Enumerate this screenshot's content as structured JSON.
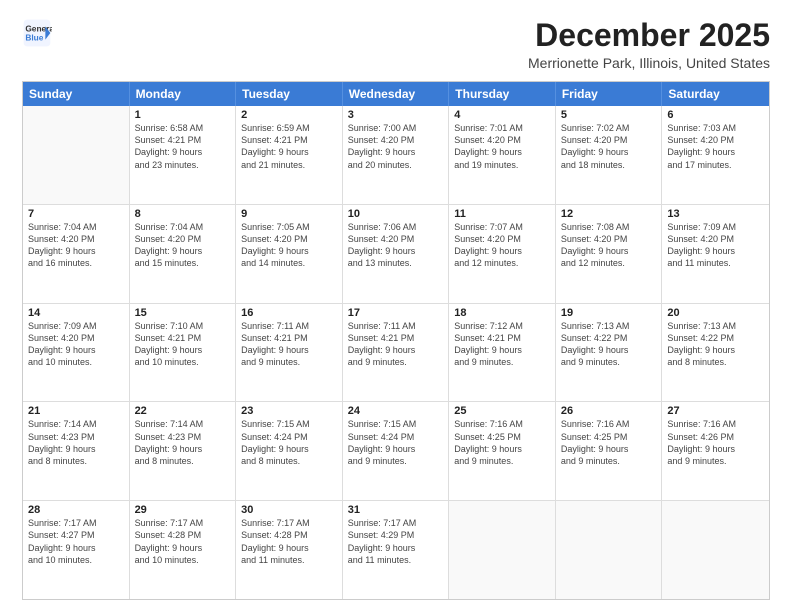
{
  "logo": {
    "line1": "General",
    "line2": "Blue"
  },
  "title": "December 2025",
  "subtitle": "Merrionette Park, Illinois, United States",
  "days_of_week": [
    "Sunday",
    "Monday",
    "Tuesday",
    "Wednesday",
    "Thursday",
    "Friday",
    "Saturday"
  ],
  "weeks": [
    [
      {
        "day": "",
        "lines": []
      },
      {
        "day": "1",
        "lines": [
          "Sunrise: 6:58 AM",
          "Sunset: 4:21 PM",
          "Daylight: 9 hours",
          "and 23 minutes."
        ]
      },
      {
        "day": "2",
        "lines": [
          "Sunrise: 6:59 AM",
          "Sunset: 4:21 PM",
          "Daylight: 9 hours",
          "and 21 minutes."
        ]
      },
      {
        "day": "3",
        "lines": [
          "Sunrise: 7:00 AM",
          "Sunset: 4:20 PM",
          "Daylight: 9 hours",
          "and 20 minutes."
        ]
      },
      {
        "day": "4",
        "lines": [
          "Sunrise: 7:01 AM",
          "Sunset: 4:20 PM",
          "Daylight: 9 hours",
          "and 19 minutes."
        ]
      },
      {
        "day": "5",
        "lines": [
          "Sunrise: 7:02 AM",
          "Sunset: 4:20 PM",
          "Daylight: 9 hours",
          "and 18 minutes."
        ]
      },
      {
        "day": "6",
        "lines": [
          "Sunrise: 7:03 AM",
          "Sunset: 4:20 PM",
          "Daylight: 9 hours",
          "and 17 minutes."
        ]
      }
    ],
    [
      {
        "day": "7",
        "lines": [
          "Sunrise: 7:04 AM",
          "Sunset: 4:20 PM",
          "Daylight: 9 hours",
          "and 16 minutes."
        ]
      },
      {
        "day": "8",
        "lines": [
          "Sunrise: 7:04 AM",
          "Sunset: 4:20 PM",
          "Daylight: 9 hours",
          "and 15 minutes."
        ]
      },
      {
        "day": "9",
        "lines": [
          "Sunrise: 7:05 AM",
          "Sunset: 4:20 PM",
          "Daylight: 9 hours",
          "and 14 minutes."
        ]
      },
      {
        "day": "10",
        "lines": [
          "Sunrise: 7:06 AM",
          "Sunset: 4:20 PM",
          "Daylight: 9 hours",
          "and 13 minutes."
        ]
      },
      {
        "day": "11",
        "lines": [
          "Sunrise: 7:07 AM",
          "Sunset: 4:20 PM",
          "Daylight: 9 hours",
          "and 12 minutes."
        ]
      },
      {
        "day": "12",
        "lines": [
          "Sunrise: 7:08 AM",
          "Sunset: 4:20 PM",
          "Daylight: 9 hours",
          "and 12 minutes."
        ]
      },
      {
        "day": "13",
        "lines": [
          "Sunrise: 7:09 AM",
          "Sunset: 4:20 PM",
          "Daylight: 9 hours",
          "and 11 minutes."
        ]
      }
    ],
    [
      {
        "day": "14",
        "lines": [
          "Sunrise: 7:09 AM",
          "Sunset: 4:20 PM",
          "Daylight: 9 hours",
          "and 10 minutes."
        ]
      },
      {
        "day": "15",
        "lines": [
          "Sunrise: 7:10 AM",
          "Sunset: 4:21 PM",
          "Daylight: 9 hours",
          "and 10 minutes."
        ]
      },
      {
        "day": "16",
        "lines": [
          "Sunrise: 7:11 AM",
          "Sunset: 4:21 PM",
          "Daylight: 9 hours",
          "and 9 minutes."
        ]
      },
      {
        "day": "17",
        "lines": [
          "Sunrise: 7:11 AM",
          "Sunset: 4:21 PM",
          "Daylight: 9 hours",
          "and 9 minutes."
        ]
      },
      {
        "day": "18",
        "lines": [
          "Sunrise: 7:12 AM",
          "Sunset: 4:21 PM",
          "Daylight: 9 hours",
          "and 9 minutes."
        ]
      },
      {
        "day": "19",
        "lines": [
          "Sunrise: 7:13 AM",
          "Sunset: 4:22 PM",
          "Daylight: 9 hours",
          "and 9 minutes."
        ]
      },
      {
        "day": "20",
        "lines": [
          "Sunrise: 7:13 AM",
          "Sunset: 4:22 PM",
          "Daylight: 9 hours",
          "and 8 minutes."
        ]
      }
    ],
    [
      {
        "day": "21",
        "lines": [
          "Sunrise: 7:14 AM",
          "Sunset: 4:23 PM",
          "Daylight: 9 hours",
          "and 8 minutes."
        ]
      },
      {
        "day": "22",
        "lines": [
          "Sunrise: 7:14 AM",
          "Sunset: 4:23 PM",
          "Daylight: 9 hours",
          "and 8 minutes."
        ]
      },
      {
        "day": "23",
        "lines": [
          "Sunrise: 7:15 AM",
          "Sunset: 4:24 PM",
          "Daylight: 9 hours",
          "and 8 minutes."
        ]
      },
      {
        "day": "24",
        "lines": [
          "Sunrise: 7:15 AM",
          "Sunset: 4:24 PM",
          "Daylight: 9 hours",
          "and 9 minutes."
        ]
      },
      {
        "day": "25",
        "lines": [
          "Sunrise: 7:16 AM",
          "Sunset: 4:25 PM",
          "Daylight: 9 hours",
          "and 9 minutes."
        ]
      },
      {
        "day": "26",
        "lines": [
          "Sunrise: 7:16 AM",
          "Sunset: 4:25 PM",
          "Daylight: 9 hours",
          "and 9 minutes."
        ]
      },
      {
        "day": "27",
        "lines": [
          "Sunrise: 7:16 AM",
          "Sunset: 4:26 PM",
          "Daylight: 9 hours",
          "and 9 minutes."
        ]
      }
    ],
    [
      {
        "day": "28",
        "lines": [
          "Sunrise: 7:17 AM",
          "Sunset: 4:27 PM",
          "Daylight: 9 hours",
          "and 10 minutes."
        ]
      },
      {
        "day": "29",
        "lines": [
          "Sunrise: 7:17 AM",
          "Sunset: 4:28 PM",
          "Daylight: 9 hours",
          "and 10 minutes."
        ]
      },
      {
        "day": "30",
        "lines": [
          "Sunrise: 7:17 AM",
          "Sunset: 4:28 PM",
          "Daylight: 9 hours",
          "and 11 minutes."
        ]
      },
      {
        "day": "31",
        "lines": [
          "Sunrise: 7:17 AM",
          "Sunset: 4:29 PM",
          "Daylight: 9 hours",
          "and 11 minutes."
        ]
      },
      {
        "day": "",
        "lines": []
      },
      {
        "day": "",
        "lines": []
      },
      {
        "day": "",
        "lines": []
      }
    ]
  ]
}
